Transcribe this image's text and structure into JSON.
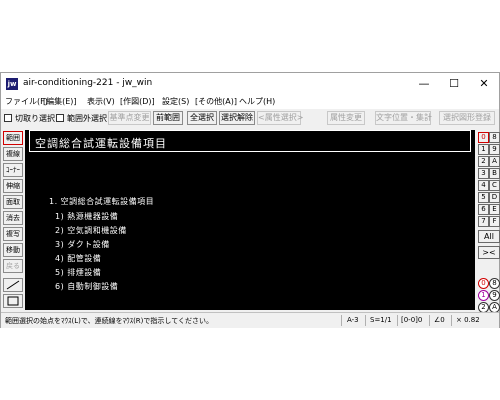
{
  "window": {
    "title": "air-conditioning-221 - jw_win",
    "app_icon_text": "jw",
    "controls": {
      "minimize": "—",
      "maximize": "☐",
      "close": "✕"
    }
  },
  "menu": [
    "ファイル(F)",
    "[編集(E)]",
    "表示(V)",
    "[作図(D)]",
    "設定(S)",
    "[その他(A)]",
    "ヘルプ(H)"
  ],
  "toolbar": {
    "check1_label": "切取り選択",
    "check2_label": "範囲外選択",
    "base_point_change": "基準点変更",
    "prev_range": "前範囲",
    "select_all": "全選択",
    "deselect": "選択解除",
    "attr_select": "<属性選択>",
    "attr_change": "属性変更",
    "text_pos": "文字位置・集計",
    "register": "選択図形登録"
  },
  "left_tools": [
    {
      "label": "範囲",
      "active": true
    },
    {
      "label": "複線",
      "active": false
    },
    {
      "label": "ｺｰﾅｰ",
      "active": false
    },
    {
      "label": "伸縮",
      "active": false
    },
    {
      "label": "面取",
      "active": false
    },
    {
      "label": "消去",
      "active": false
    },
    {
      "label": "複写",
      "active": false
    },
    {
      "label": "移動",
      "active": false
    },
    {
      "label": "戻る",
      "active": false,
      "disabled": true
    }
  ],
  "right_panel": {
    "layer_group_rows": [
      [
        "0",
        "8"
      ],
      [
        "1",
        "9"
      ],
      [
        "2",
        "A"
      ],
      [
        "3",
        "B"
      ],
      [
        "4",
        "C"
      ],
      [
        "5",
        "D"
      ],
      [
        "6",
        "E"
      ],
      [
        "7",
        "F"
      ]
    ],
    "all_label": "All",
    "xchg_label": "><",
    "circle_rows": [
      [
        "0",
        "8"
      ],
      [
        "1",
        "9"
      ],
      [
        "2",
        "A"
      ]
    ]
  },
  "canvas": {
    "title": "空調総合試運転設備項目",
    "lines": [
      "1. 空調総合試運転設備項目",
      "1) 熱源機器設備",
      "2) 空気調和機設備",
      "3) ダクト設備",
      "4) 配管設備",
      "5) 排煙設備",
      "6) 自動制御設備"
    ]
  },
  "status": {
    "message": "範囲選択の始点をﾏｳｽ(L)で、連続線をﾏｳｽ(R)で指示してください。",
    "paper": "A-3",
    "scale": "S=1/1",
    "layer": "[0-0]0",
    "angle": "∠0",
    "zoom": "× 0.82"
  },
  "colors": {
    "canvas_bg": "#000000",
    "canvas_text": "#ffffff",
    "active_red": "#d00000",
    "purple": "#a000a0"
  }
}
